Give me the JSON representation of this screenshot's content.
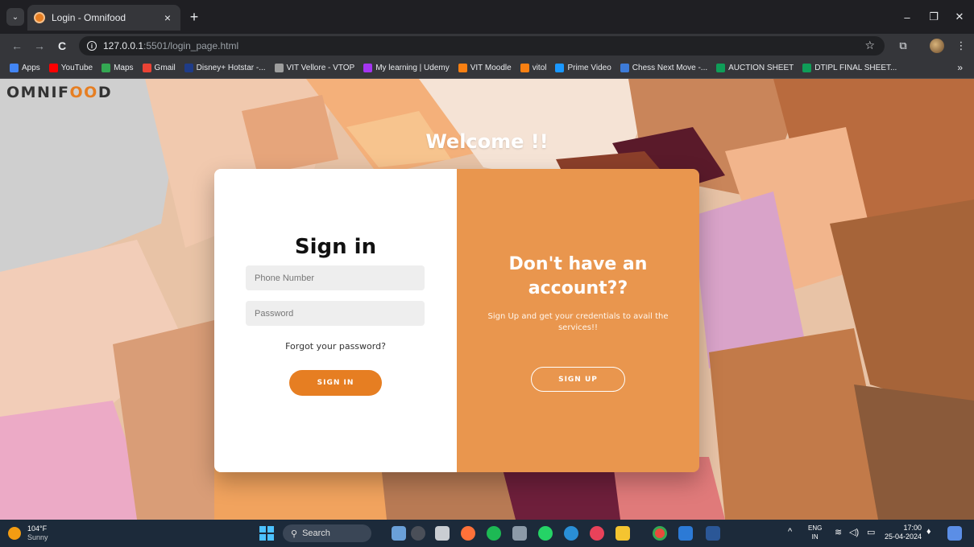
{
  "browser": {
    "tab_title": "Login - Omnifood",
    "tab_close": "×",
    "new_tab": "+",
    "tab_menu": "⌄",
    "window_controls": {
      "minimize": "–",
      "restore": "❐",
      "close": "✕"
    },
    "nav": {
      "back": "←",
      "forward": "→",
      "reload": "C"
    },
    "url_host": "127.0.0.1",
    "url_path": ":5501/login_page.html",
    "star": "☆",
    "more": "⋮",
    "bookmarks": [
      {
        "label": "Apps",
        "icon": "apps-grid-icon",
        "color": "#4285f4"
      },
      {
        "label": "YouTube",
        "icon": "youtube-icon",
        "color": "#ff0000"
      },
      {
        "label": "Maps",
        "icon": "maps-icon",
        "color": "#34a853"
      },
      {
        "label": "Gmail",
        "icon": "gmail-icon",
        "color": "#ea4335"
      },
      {
        "label": "Disney+ Hotstar -...",
        "icon": "hotstar-icon",
        "color": "#1f3c88"
      },
      {
        "label": "VIT Vellore - VTOP",
        "icon": "vtop-icon",
        "color": "#9e9e9e"
      },
      {
        "label": "My learning | Udemy",
        "icon": "udemy-icon",
        "color": "#a435f0"
      },
      {
        "label": "VIT Moodle",
        "icon": "moodle-icon",
        "color": "#f98012"
      },
      {
        "label": "vitol",
        "icon": "vitol-icon",
        "color": "#f98012"
      },
      {
        "label": "Prime Video",
        "icon": "prime-video-icon",
        "color": "#1a98ff"
      },
      {
        "label": "Chess Next Move -...",
        "icon": "chess-icon",
        "color": "#3d7bd8"
      },
      {
        "label": "AUCTION SHEET",
        "icon": "sheets-icon",
        "color": "#0f9d58"
      },
      {
        "label": "DTIPL FINAL SHEET...",
        "icon": "sheets-icon",
        "color": "#0f9d58"
      }
    ],
    "bookmarks_more": "»"
  },
  "page": {
    "logo_pre": "OMNIF",
    "logo_oo": "OO",
    "logo_post": "D",
    "welcome": "Welcome !!",
    "signin": {
      "title": "Sign in",
      "phone_placeholder": "Phone Number",
      "password_placeholder": "Password",
      "forgot": "Forgot your password?",
      "button": "SIGN IN"
    },
    "signup": {
      "title": "Don't have an account??",
      "subtitle": "Sign Up and get your credentials to avail the services!!",
      "button": "SIGN UP"
    }
  },
  "taskbar": {
    "temperature": "104°F",
    "condition": "Sunny",
    "search": "Search",
    "lang_top": "ENG",
    "lang_bottom": "IN",
    "time": "17:00",
    "date": "25-04-2024",
    "tray_chevron": "^"
  },
  "colors": {
    "accent": "#e67e22",
    "panel": "#e9964e"
  }
}
